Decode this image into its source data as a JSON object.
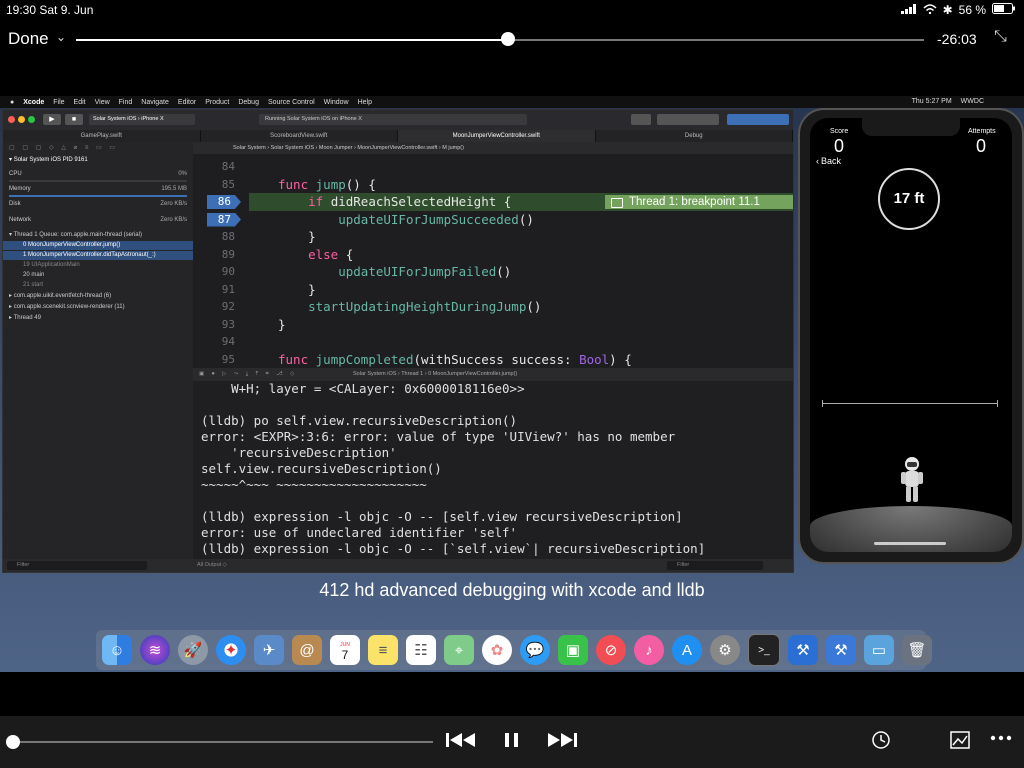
{
  "status_bar": {
    "time_date": "19:30  Sat 9. Jun",
    "battery": "56 %"
  },
  "player": {
    "done_label": "Done",
    "time_remaining": "-26:03",
    "progress_fraction": 0.51,
    "bottom_progress_fraction": 0.0
  },
  "mac_menubar": {
    "items": [
      "Xcode",
      "File",
      "Edit",
      "View",
      "Find",
      "Navigate",
      "Editor",
      "Product",
      "Debug",
      "Source Control",
      "Window",
      "Help"
    ],
    "clock": "Thu 5:27 PM",
    "user": "WWDC"
  },
  "xcode": {
    "scheme": "Solar System iOS",
    "device": "iPhone X",
    "activity": "Running Solar System iOS on iPhone X",
    "tabs": [
      "GamePlay.swift",
      "ScoreboardView.swift",
      "MoonJumperViewController.swift",
      "Debug"
    ],
    "jump_bar": "Solar System  ›  Solar System iOS  ›  Moon Jumper  ›  MoonJumperViewController.swift  ›  M  jump()",
    "navigator": {
      "process": "Solar System iOS PID 9161",
      "gauges": [
        {
          "label": "CPU",
          "value": "0%"
        },
        {
          "label": "Memory",
          "value": "195.5 MB"
        },
        {
          "label": "Disk",
          "value": "Zero KB/s"
        },
        {
          "label": "Network",
          "value": "Zero KB/s"
        }
      ],
      "threads": [
        "Thread 1  Queue: com.apple.main-thread (serial)",
        "0 MoonJumperViewController.jump()",
        "1 MoonJumperViewController.didTapAstronaut(_:)",
        "19 UIApplicationMain",
        "20 main",
        "21 start",
        "com.apple.uikit.eventfetch-thread (6)",
        "com.apple.scenekit.scnview-renderer (11)",
        "Thread 49"
      ],
      "filter_placeholder": "Filter"
    },
    "code_lines": [
      {
        "n": "84",
        "t": ""
      },
      {
        "n": "85",
        "t": "    func jump() {"
      },
      {
        "n": "86",
        "t": "        if didReachSelectedHeight {"
      },
      {
        "n": "87",
        "t": "            updateUIForJumpSucceeded()"
      },
      {
        "n": "88",
        "t": "        }"
      },
      {
        "n": "89",
        "t": "        else {"
      },
      {
        "n": "90",
        "t": "            updateUIForJumpFailed()"
      },
      {
        "n": "91",
        "t": "        }"
      },
      {
        "n": "92",
        "t": "        startUpdatingHeightDuringJump()"
      },
      {
        "n": "93",
        "t": "    }"
      },
      {
        "n": "94",
        "t": ""
      },
      {
        "n": "95",
        "t": "    func jumpCompleted(withSuccess success: Bool) {"
      }
    ],
    "breakpoint_label": "Thread 1: breakpoint 11.1",
    "debug_bar_path": "Solar System iOS  ›  Thread 1  ›  0 MoonJumperViewController.jump()",
    "console_lines": [
      "    W+H; layer = <CALayer: 0x6000018116e0>>",
      "",
      "(lldb) po self.view.recursiveDescription()",
      "error: <EXPR>:3:6: error: value of type 'UIView?' has no member",
      "    'recursiveDescription'",
      "self.view.recursiveDescription()",
      "~~~~~^~~~ ~~~~~~~~~~~~~~~~~~~~",
      "",
      "(lldb) expression -l objc -O -- [self.view recursiveDescription]",
      "error: use of undeclared identifier 'self'",
      "(lldb) expression -l objc -O -- [`self.view`| recursiveDescription]"
    ],
    "output_selector": "All Output ◇",
    "console_filter": "Filter"
  },
  "simulator": {
    "score_label": "Score",
    "score_value": "0",
    "attempts_label": "Attempts",
    "attempts_value": "0",
    "back_label": "Back",
    "height_label": "17 ft"
  },
  "caption": "412 hd advanced debugging with xcode and lldb",
  "dock_icons": [
    "finder-icon",
    "siri-icon",
    "launchpad-icon",
    "safari-icon",
    "preview-icon",
    "contacts-icon",
    "calendar-icon",
    "notes-icon",
    "reminders-icon",
    "maps-icon",
    "photos-icon",
    "messages-icon",
    "facetime-icon",
    "news-icon",
    "itunes-icon",
    "appstore-icon",
    "system-preferences-icon",
    "terminal-icon",
    "xcode-icon",
    "instruments-icon",
    "folder-icon",
    "trash-icon"
  ],
  "calendar_day": "7",
  "calendar_month": "JUN"
}
